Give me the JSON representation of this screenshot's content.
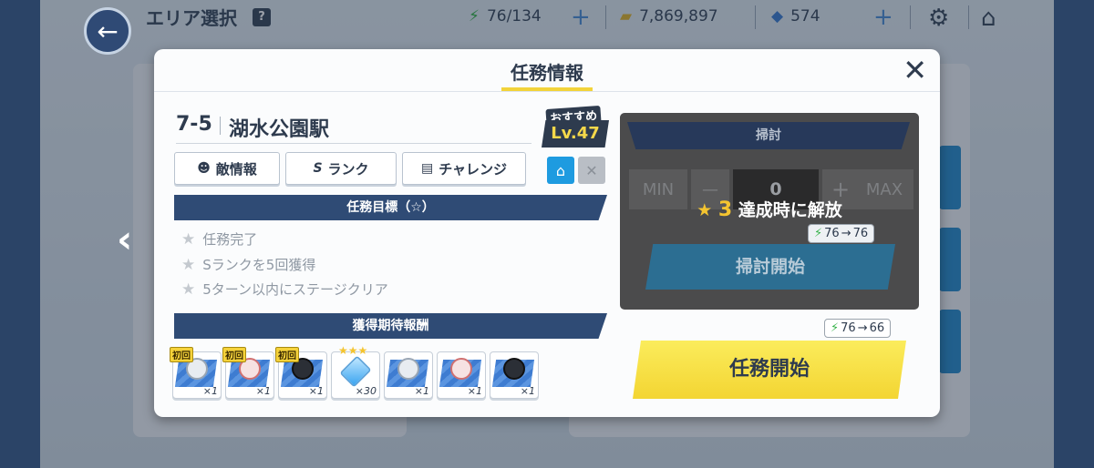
{
  "topbar": {
    "title": "エリア選択",
    "help": "?",
    "stamina": "76/134",
    "credits": "7,869,897",
    "gems": "574"
  },
  "modal": {
    "title": "任務情報",
    "close": "✕",
    "stage_code": "7-5",
    "stage_name": "湖水公園駅",
    "recommended_label": "おすすめ",
    "recommended_level": "Lv.47",
    "tabs": [
      {
        "label": "敵情報",
        "icon": "enemy-icon"
      },
      {
        "label": "ランク",
        "icon": "rank-icon"
      },
      {
        "label": "チャレンジ",
        "icon": "challenge-icon"
      }
    ],
    "objectives_header": "任務目標（☆）",
    "objectives": [
      "任務完了",
      "Sランクを5回獲得",
      "5ターン以内にステージクリア"
    ],
    "rewards_header": "獲得期待報酬",
    "rewards": [
      {
        "badge": "初回",
        "qty": "×1"
      },
      {
        "badge": "初回",
        "qty": "×1"
      },
      {
        "badge": "初回",
        "qty": "×1"
      },
      {
        "badge": "",
        "qty": "×30"
      },
      {
        "badge": "",
        "qty": "×1"
      },
      {
        "badge": "",
        "qty": "×1"
      },
      {
        "badge": "",
        "qty": "×1"
      }
    ]
  },
  "sweep": {
    "header": "掃討",
    "min": "MIN",
    "minus": "—",
    "count": "0",
    "plus": "+",
    "max": "MAX",
    "unlock_stars": "3",
    "unlock_text": "達成時に解放",
    "stamina_from": "76",
    "stamina_arrow": "→",
    "stamina_to": "76",
    "start_label": "掃討開始"
  },
  "mission_start": {
    "stamina_from": "76",
    "stamina_arrow": "→",
    "stamina_to": "66",
    "label": "任務開始"
  },
  "colors": {
    "navy": "#2f4b75",
    "accent_yellow": "#f3d532",
    "stamina_green": "#37b34a"
  }
}
